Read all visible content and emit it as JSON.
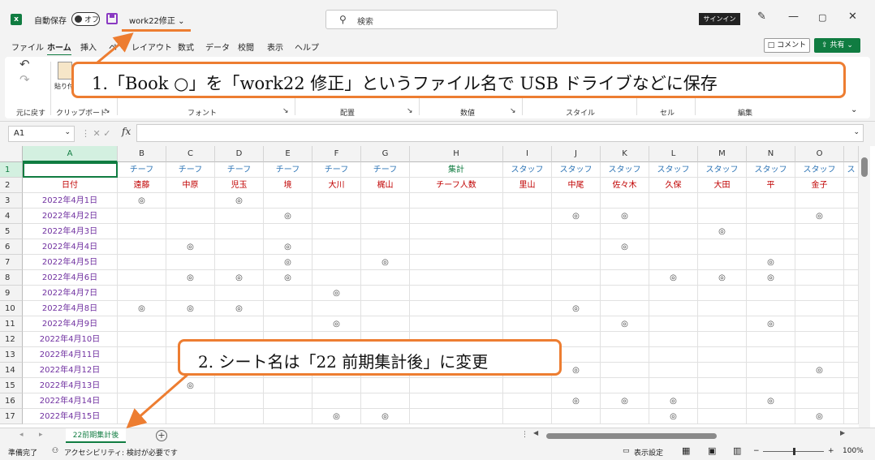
{
  "titlebar": {
    "autosave_label": "自動保存",
    "autosave_state": "オフ",
    "doc_name": "work22修正 ⌄",
    "search_placeholder": "検索",
    "signin": "サインイン",
    "icons": [
      "excel-icon",
      "save-icon",
      "pen-icon",
      "minimize-icon",
      "restore-icon",
      "close-icon"
    ]
  },
  "menu": {
    "items": [
      "ファイル",
      "ホーム",
      "挿入",
      "ペ",
      "レイアウト",
      "数式",
      "データ",
      "校閲",
      "表示",
      "ヘルプ"
    ],
    "active": "ホーム",
    "comment": "コメント",
    "share": "共有"
  },
  "ribbon": {
    "undo_label": "元に戻す",
    "paste_label": "貼り付",
    "groups": [
      "クリップボード",
      "フォント",
      "配置",
      "数値",
      "スタイル",
      "セル",
      "編集"
    ]
  },
  "formula_bar": {
    "name_box": "A1",
    "fx": "fx",
    "formula": ""
  },
  "grid": {
    "columns": [
      "A",
      "B",
      "C",
      "D",
      "E",
      "F",
      "G",
      "H",
      "I",
      "J",
      "K",
      "L",
      "M",
      "N",
      "O"
    ],
    "row_numbers": [
      "1",
      "2",
      "3",
      "4",
      "5",
      "6",
      "7",
      "8",
      "9",
      "10",
      "11",
      "12",
      "13",
      "14",
      "15",
      "16",
      "17"
    ],
    "row1": [
      "",
      "チーフ",
      "チーフ",
      "チーフ",
      "チーフ",
      "チーフ",
      "チーフ",
      "集計",
      "スタッフ",
      "スタッフ",
      "スタッフ",
      "スタッフ",
      "スタッフ",
      "スタッフ",
      "スタッフ"
    ],
    "row2": [
      "日付",
      "遠藤",
      "中原",
      "児玉",
      "境",
      "大川",
      "梶山",
      "チーフ人数",
      "里山",
      "中尾",
      "佐々木",
      "久保",
      "大田",
      "平",
      "金子"
    ],
    "dates": [
      "2022年4月1日",
      "2022年4月2日",
      "2022年4月3日",
      "2022年4月4日",
      "2022年4月5日",
      "2022年4月6日",
      "2022年4月7日",
      "2022年4月8日",
      "2022年4月9日",
      "2022年4月10日",
      "2022年4月11日",
      "2022年4月12日",
      "2022年4月13日",
      "2022年4月14日",
      "2022年4月15日"
    ],
    "mark": "◎",
    "marks": [
      [
        1,
        3
      ],
      [
        4,
        9,
        10,
        14
      ],
      [
        12
      ],
      [
        2,
        4,
        10
      ],
      [
        4,
        6,
        13
      ],
      [
        2,
        3,
        4,
        11,
        12,
        13
      ],
      [
        5
      ],
      [
        1,
        2,
        3,
        9
      ],
      [
        5,
        10,
        13
      ],
      [],
      [],
      [
        9,
        14
      ],
      [
        2
      ],
      [
        9,
        10,
        11,
        13
      ],
      [
        5,
        6,
        11,
        14
      ]
    ],
    "colors": {
      "chief": "#2e75b6",
      "staff": "#2e75b6",
      "total": "#107c41",
      "name": "#c00000",
      "date": "#7030a0"
    }
  },
  "sheets": {
    "active": "22前期集計後"
  },
  "statusbar": {
    "ready": "準備完了",
    "accessibility": "アクセシビリティ: 検討が必要です",
    "display_settings": "表示設定",
    "zoom": "100%"
  },
  "callouts": {
    "step1": "1.「Book ○」を「work22 修正」というファイル名で USB ドライブなどに保存",
    "step2": "2. シート名は「22 前期集計後」に変更"
  }
}
